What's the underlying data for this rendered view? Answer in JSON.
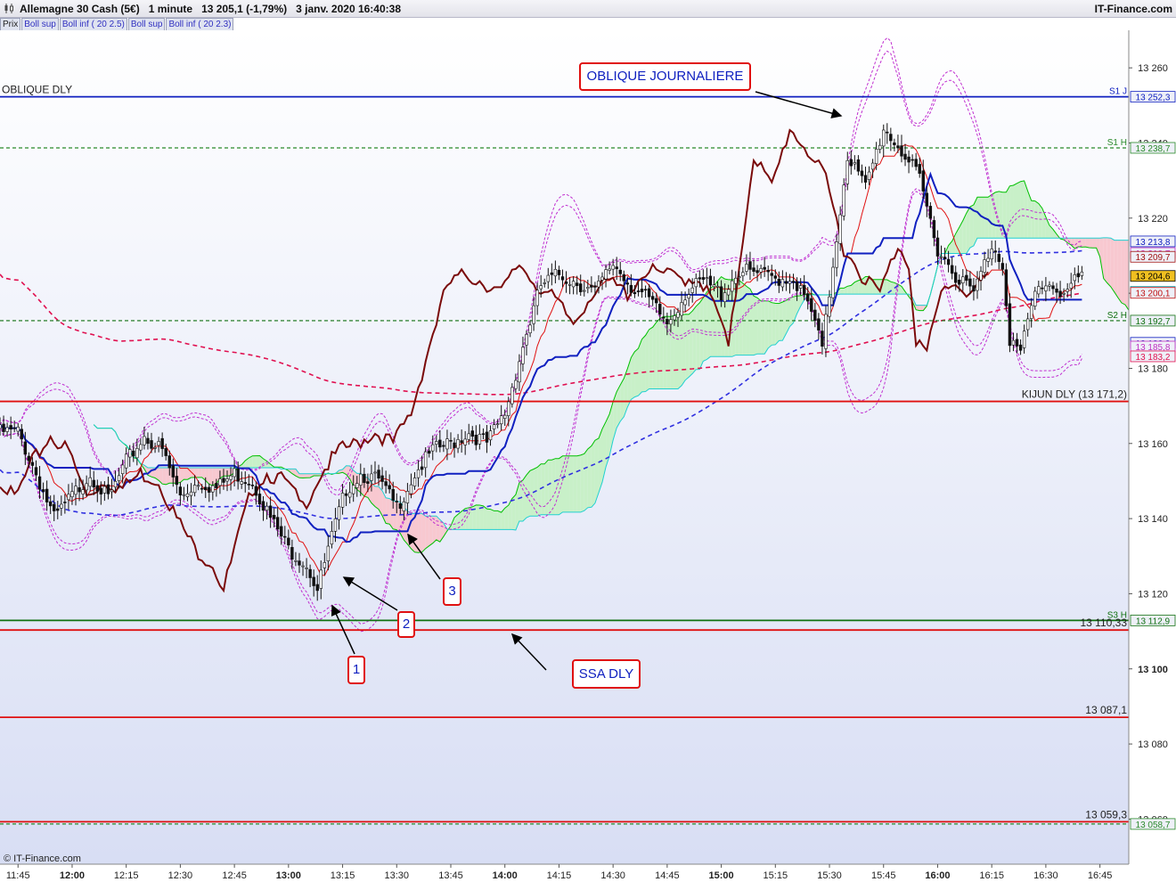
{
  "header": {
    "title": "Allemagne 30 Cash (5€)   1 minute   13 205,1 (-1,79%)   3 janv. 2020 16:40:38",
    "brand": "IT-Finance.com"
  },
  "legend_tabs": [
    {
      "label": "Prix",
      "color": "#222222"
    },
    {
      "label": "Boll sup",
      "color": "#3030c0"
    },
    {
      "label": "Boll inf ( 20 2.5)",
      "color": "#3030c0"
    },
    {
      "label": "Boll sup",
      "color": "#3030c0"
    },
    {
      "label": "Boll inf ( 20 2.3)",
      "color": "#3030c0"
    }
  ],
  "footer": "© IT-Finance.com",
  "annotations": {
    "oblique_journaliere": "OBLIQUE JOURNALIERE",
    "ssa_dly": "SSA DLY",
    "marker_1": "1",
    "marker_2": "2",
    "marker_3": "3"
  },
  "chart_data": {
    "type": "candlestick",
    "instrument": "Allemagne 30 Cash (5€)",
    "timeframe": "1 minute",
    "x_ticks": [
      "11:45",
      "12:00",
      "12:15",
      "12:30",
      "12:45",
      "13:00",
      "13:15",
      "13:30",
      "13:45",
      "14:00",
      "14:15",
      "14:30",
      "14:45",
      "15:00",
      "15:15",
      "15:30",
      "15:45",
      "16:00",
      "16:15",
      "16:30",
      "16:45"
    ],
    "bold_x_ticks": [
      "12:00",
      "13:00",
      "14:00",
      "15:00",
      "16:00"
    ],
    "y_ticks": [
      13260,
      13240,
      13220,
      13200,
      13180,
      13160,
      13140,
      13120,
      13100,
      13080,
      13060
    ],
    "y_tick_labels": [
      "13 260",
      "13 240",
      "13 220",
      "13 200",
      "13 180",
      "13 160",
      "13 140",
      "13 120",
      "13 100",
      "13 080",
      "13 060"
    ],
    "ylim": [
      13048,
      13270
    ],
    "xlim": [
      "11:40",
      "16:53"
    ],
    "last_price": 13205.1,
    "price_key": [
      {
        "t": "11:40",
        "p": 13163
      },
      {
        "t": "11:45",
        "p": 13163
      },
      {
        "t": "11:50",
        "p": 13152
      },
      {
        "t": "11:55",
        "p": 13140
      },
      {
        "t": "12:00",
        "p": 13146
      },
      {
        "t": "12:05",
        "p": 13152
      },
      {
        "t": "12:10",
        "p": 13145
      },
      {
        "t": "12:15",
        "p": 13155
      },
      {
        "t": "12:20",
        "p": 13162
      },
      {
        "t": "12:25",
        "p": 13158
      },
      {
        "t": "12:30",
        "p": 13146
      },
      {
        "t": "12:35",
        "p": 13150
      },
      {
        "t": "12:40",
        "p": 13148
      },
      {
        "t": "12:45",
        "p": 13152
      },
      {
        "t": "12:50",
        "p": 13150
      },
      {
        "t": "12:55",
        "p": 13140
      },
      {
        "t": "13:00",
        "p": 13132
      },
      {
        "t": "13:05",
        "p": 13128
      },
      {
        "t": "13:08",
        "p": 13121
      },
      {
        "t": "13:12",
        "p": 13135
      },
      {
        "t": "13:16",
        "p": 13148
      },
      {
        "t": "13:20",
        "p": 13152
      },
      {
        "t": "13:25",
        "p": 13150
      },
      {
        "t": "13:30",
        "p": 13143
      },
      {
        "t": "13:35",
        "p": 13152
      },
      {
        "t": "13:40",
        "p": 13158
      },
      {
        "t": "13:45",
        "p": 13160
      },
      {
        "t": "13:50",
        "p": 13163
      },
      {
        "t": "13:55",
        "p": 13160
      },
      {
        "t": "14:00",
        "p": 13168
      },
      {
        "t": "14:05",
        "p": 13186
      },
      {
        "t": "14:10",
        "p": 13202
      },
      {
        "t": "14:15",
        "p": 13205
      },
      {
        "t": "14:20",
        "p": 13203
      },
      {
        "t": "14:25",
        "p": 13200
      },
      {
        "t": "14:30",
        "p": 13208
      },
      {
        "t": "14:35",
        "p": 13202
      },
      {
        "t": "14:40",
        "p": 13198
      },
      {
        "t": "14:45",
        "p": 13192
      },
      {
        "t": "14:50",
        "p": 13200
      },
      {
        "t": "14:55",
        "p": 13203
      },
      {
        "t": "15:00",
        "p": 13200
      },
      {
        "t": "15:05",
        "p": 13206
      },
      {
        "t": "15:10",
        "p": 13205
      },
      {
        "t": "15:15",
        "p": 13204
      },
      {
        "t": "15:20",
        "p": 13204
      },
      {
        "t": "15:25",
        "p": 13195
      },
      {
        "t": "15:28",
        "p": 13185
      },
      {
        "t": "15:32",
        "p": 13215
      },
      {
        "t": "15:35",
        "p": 13237
      },
      {
        "t": "15:40",
        "p": 13228
      },
      {
        "t": "15:45",
        "p": 13244
      },
      {
        "t": "15:50",
        "p": 13238
      },
      {
        "t": "15:55",
        "p": 13230
      },
      {
        "t": "16:00",
        "p": 13212
      },
      {
        "t": "16:05",
        "p": 13205
      },
      {
        "t": "16:10",
        "p": 13200
      },
      {
        "t": "16:15",
        "p": 13213
      },
      {
        "t": "16:18",
        "p": 13208
      },
      {
        "t": "16:20",
        "p": 13188
      },
      {
        "t": "16:23",
        "p": 13184
      },
      {
        "t": "16:27",
        "p": 13200
      },
      {
        "t": "16:30",
        "p": 13203
      },
      {
        "t": "16:35",
        "p": 13200
      },
      {
        "t": "16:40",
        "p": 13205
      }
    ],
    "horizontal_levels": [
      {
        "name": "OBLIQUE DLY",
        "value": 13252.3,
        "color": "#1020c0",
        "style": "solid",
        "label": "OBLIQUE DLY",
        "label_side": "left",
        "badge": "13 252,3",
        "tag": "S1 J"
      },
      {
        "name": "S1 H",
        "value": 13238.7,
        "color": "#2a8a2a",
        "style": "dashed",
        "badge": "13 238,7",
        "tag": "S1 H"
      },
      {
        "name": "S2 H",
        "value": 13192.7,
        "color": "#107010",
        "style": "dashed",
        "badge": "13 192,7",
        "tag": "S2 H"
      },
      {
        "name": "KIJUN DLY",
        "value": 13171.2,
        "color": "#e01010",
        "style": "solid",
        "label": "KIJUN DLY (13 171,2)",
        "label_side": "right"
      },
      {
        "name": "S3 H",
        "value": 13112.9,
        "color": "#107010",
        "style": "solid",
        "badge": "13 112,9",
        "tag": "S3 H"
      },
      {
        "name": "SSA DLY",
        "value": 13110.33,
        "color": "#e01010",
        "style": "solid",
        "label": "13 110,33",
        "label_side": "right"
      },
      {
        "name": "level-13087",
        "value": 13087.1,
        "color": "#e01010",
        "style": "solid",
        "label": "13 087,1",
        "label_side": "right"
      },
      {
        "name": "level-13059",
        "value": 13059.3,
        "color": "#e01010",
        "style": "solid",
        "label": "13 059,3",
        "label_side": "right"
      },
      {
        "name": "level-13058",
        "value": 13058.7,
        "color": "#2a8a2a",
        "style": "dashed",
        "badge": "13 058,7"
      }
    ],
    "right_badges": [
      {
        "value": 13213.8,
        "label": "13 213,8",
        "color": "#1020c0"
      },
      {
        "value": 13210.7,
        "label": "13 210,7",
        "color": "#c030c0"
      },
      {
        "value": 13209.7,
        "label": "13 209,7",
        "color": "#a01010"
      },
      {
        "value": 13204.6,
        "label": "13 204,6",
        "color": "#000000",
        "highlight": true
      },
      {
        "value": 13200.4,
        "label": "13 200,4",
        "color": "#20b0c0"
      },
      {
        "value": 13200.1,
        "label": "13 200,1",
        "color": "#c01010"
      },
      {
        "value": 13186.8,
        "label": "13 186,8",
        "color": "#1020c0"
      },
      {
        "value": 13185.8,
        "label": "13 185,8",
        "color": "#c030c0"
      },
      {
        "value": 13183.2,
        "label": "13 183,2",
        "color": "#e01050"
      }
    ],
    "colors": {
      "kijun": "#1020c0",
      "tenkan": "#e01010",
      "chikou": "#7a0a0a",
      "ssa": "#00c000",
      "ssb": "#20d0d0",
      "boll": "#c030d0",
      "boll_fill": "#f0a0f0",
      "daily_ma_red": "#e01050",
      "daily_ma_blue": "#3030e0",
      "cloud_bull": "#c8f0c8",
      "cloud_bear": "#f8c8d0",
      "candle_up": "#ffffff",
      "candle_down": "#111111"
    }
  }
}
